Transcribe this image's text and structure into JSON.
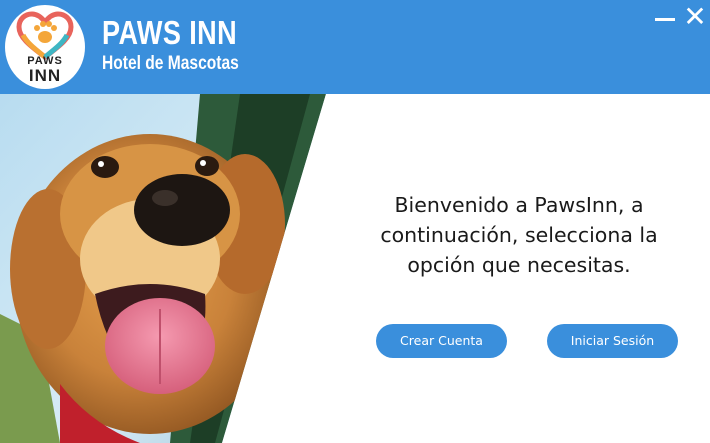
{
  "header": {
    "logo_text_line1": "PAWS",
    "logo_text_line2": "INN",
    "title": "PAWS INN",
    "subtitle": "Hotel de Mascotas",
    "bg_color": "#3a8fdc",
    "minimize_icon": "minimize-icon",
    "close_icon": "close-icon",
    "close_glyph": "✕"
  },
  "main": {
    "welcome_text": "Bienvenido a PawsInn, a continuación, selecciona la opción que necesitas.",
    "buttons": {
      "create_account": "Crear Cuenta",
      "login": "Iniciar Sesión"
    },
    "accent_color": "#3a8fdc"
  }
}
